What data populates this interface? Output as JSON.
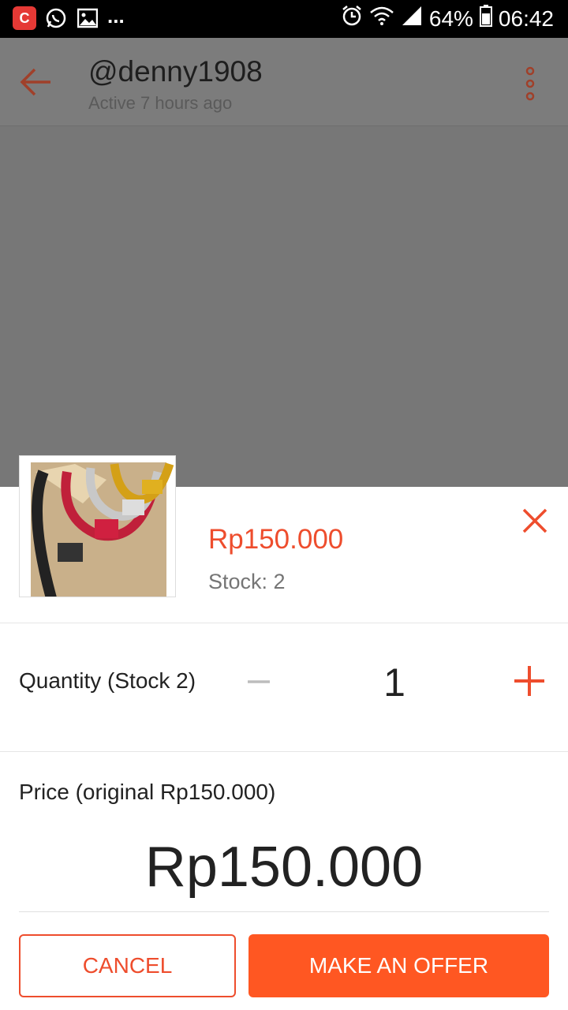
{
  "status_bar": {
    "app_badge": "C",
    "more_indicator": "...",
    "battery": "64%",
    "time": "06:42",
    "icons": [
      "app-notification-icon",
      "whatsapp-icon",
      "gallery-icon",
      "alarm-icon",
      "wifi-icon",
      "signal-icon",
      "battery-icon"
    ]
  },
  "header": {
    "username": "@denny1908",
    "status": "Active 7 hours ago",
    "icons": [
      "back-arrow-icon",
      "more-vertical-icon"
    ]
  },
  "product": {
    "price": "Rp150.000",
    "stock": "Stock: 2",
    "image_icon": "handlebar-product-image"
  },
  "quantity": {
    "label": "Quantity (Stock 2)",
    "value": "1"
  },
  "price_section": {
    "label": "Price (original Rp150.000)",
    "offer_value": "Rp150.000"
  },
  "actions": {
    "cancel_label": "CANCEL",
    "offer_label": "MAKE AN OFFER"
  },
  "colors": {
    "accent": "#ee4d2d",
    "button": "#ff5722",
    "overlay": "#777777"
  }
}
